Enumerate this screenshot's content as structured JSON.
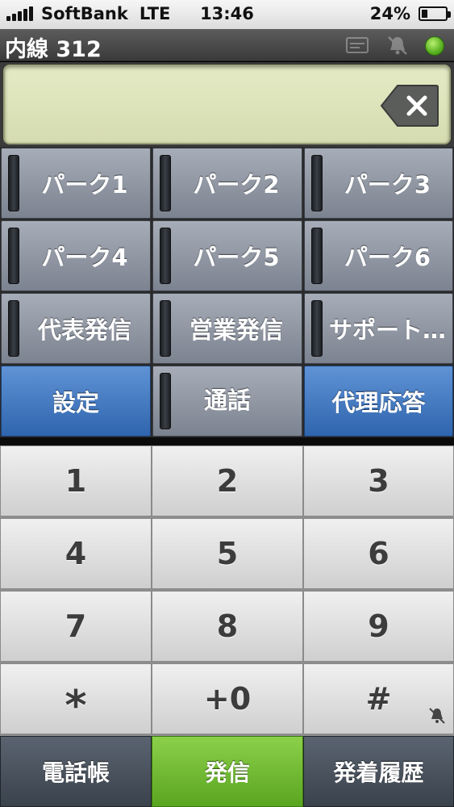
{
  "status_bar": {
    "carrier": "SoftBank",
    "network": "LTE",
    "time": "13:46",
    "battery_text": "24%",
    "battery_level": 24
  },
  "header": {
    "extension": "内線 312",
    "status_color": "#58b020"
  },
  "display": {
    "value": ""
  },
  "function_buttons": {
    "park1": "パーク1",
    "park2": "パーク2",
    "park3": "パーク3",
    "park4": "パーク4",
    "park5": "パーク5",
    "park6": "パーク6",
    "main_outbound": "代表発信",
    "sales_outbound": "営業発信",
    "support": "サポート…",
    "settings": "設定",
    "call": "通話",
    "proxy_answer": "代理応答"
  },
  "keypad": {
    "k1": "1",
    "k2": "2",
    "k3": "3",
    "k4": "4",
    "k5": "5",
    "k6": "6",
    "k7": "7",
    "k8": "8",
    "k9": "9",
    "kstar": "*",
    "k0": "+0",
    "khash": "#"
  },
  "bottom_bar": {
    "phonebook": "電話帳",
    "dial": "発信",
    "history": "発着履歴"
  },
  "colors": {
    "dial_green": "#6fbf30",
    "function_blue": "#4a7fc4"
  }
}
